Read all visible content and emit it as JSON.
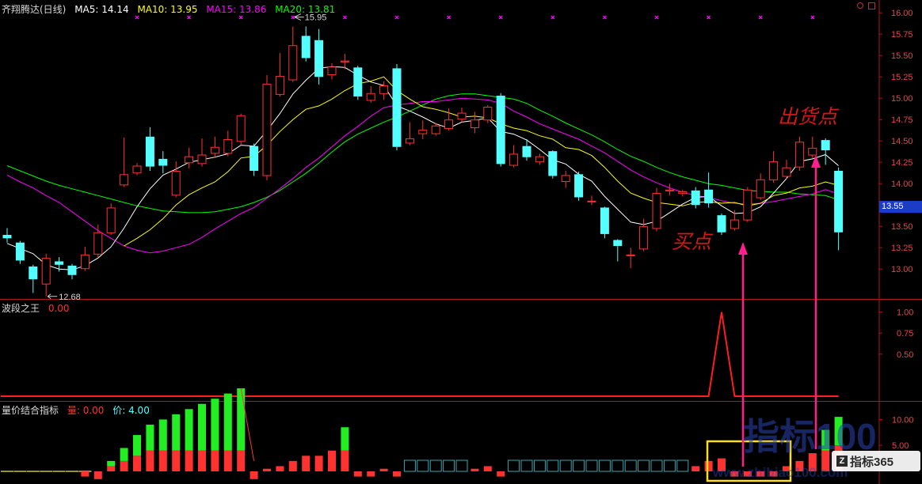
{
  "colors": {
    "up": "#ff3232",
    "down": "#54ffff",
    "ma5": "#ffffff",
    "ma10": "#ffff00",
    "ma15": "#ff00ff",
    "ma20": "#00ff00",
    "frame": "#b01818",
    "axis_text": "#e04848",
    "arrow": "#ff1e8c",
    "signal": "#ff1e1e",
    "marker": "#ff00ff"
  },
  "header": {
    "name": "齐翔腾达(日线)",
    "ma5": "MA5: 14.14",
    "ma10": "MA10: 13.95",
    "ma15": "MA15: 13.86",
    "ma20": "MA20: 13.81"
  },
  "panel2": {
    "name": "波段之王",
    "value": "0.00"
  },
  "panel3": {
    "name": "量价结合指标",
    "vol_label": "量: 0.00",
    "price_label": "价: 4.00"
  },
  "price_tag": "13.55",
  "annotations": {
    "sell_point": "出货点",
    "buy_point": "买点"
  },
  "watermarks": {
    "main": "指标100",
    "sub": "www.zhibiao100.com"
  },
  "brand": {
    "logo": "Z",
    "text": "指标365"
  },
  "chart_data": [
    {
      "type": "candlestick",
      "title": "齐翔腾达(日线)",
      "ylim": [
        12.65,
        16.15
      ],
      "yticks": [
        "16.00",
        "15.75",
        "15.50",
        "15.25",
        "15.00",
        "14.75",
        "14.50",
        "14.25",
        "14.00",
        "13.75",
        "13.50",
        "13.25",
        "13.00"
      ],
      "high_label": "15.95",
      "low_label": "12.68",
      "candles": [
        [
          13.4,
          13.36,
          13.48,
          13.31
        ],
        [
          13.31,
          13.1,
          13.33,
          13.06
        ],
        [
          13.03,
          12.88,
          13.05,
          12.72
        ],
        [
          12.82,
          13.13,
          13.18,
          12.68
        ],
        [
          13.09,
          13.05,
          13.14,
          12.97
        ],
        [
          13.04,
          12.93,
          13.06,
          12.88
        ],
        [
          13.0,
          13.17,
          13.26,
          12.98
        ],
        [
          13.17,
          13.43,
          13.52,
          13.14
        ],
        [
          13.42,
          13.72,
          13.77,
          13.4
        ],
        [
          13.98,
          14.11,
          14.54,
          13.96
        ],
        [
          14.12,
          14.21,
          14.24,
          14.1
        ],
        [
          14.55,
          14.2,
          14.66,
          14.15
        ],
        [
          14.29,
          14.21,
          14.38,
          14.12
        ],
        [
          13.86,
          14.15,
          14.26,
          13.84
        ],
        [
          14.24,
          14.32,
          14.42,
          14.18
        ],
        [
          14.23,
          14.34,
          14.53,
          14.2
        ],
        [
          14.35,
          14.43,
          14.55,
          14.3
        ],
        [
          14.35,
          14.52,
          14.62,
          14.32
        ],
        [
          14.49,
          14.8,
          14.82,
          14.45
        ],
        [
          14.44,
          14.15,
          14.47,
          14.09
        ],
        [
          14.09,
          15.17,
          15.27,
          14.04
        ],
        [
          15.04,
          15.26,
          15.53,
          15.02
        ],
        [
          15.21,
          15.62,
          15.84,
          15.19
        ],
        [
          15.73,
          15.47,
          15.84,
          15.43
        ],
        [
          15.68,
          15.25,
          15.81,
          15.16
        ],
        [
          15.27,
          15.37,
          15.41,
          15.22
        ],
        [
          15.42,
          15.44,
          15.52,
          15.34
        ],
        [
          15.36,
          15.02,
          15.38,
          14.98
        ],
        [
          14.97,
          15.06,
          15.14,
          14.95
        ],
        [
          15.05,
          15.15,
          15.2,
          14.98
        ],
        [
          15.35,
          14.43,
          15.4,
          14.39
        ],
        [
          14.47,
          14.53,
          14.72,
          14.45
        ],
        [
          14.58,
          14.63,
          14.74,
          14.52
        ],
        [
          14.58,
          14.68,
          14.71,
          14.56
        ],
        [
          14.64,
          14.75,
          14.88,
          14.62
        ],
        [
          14.75,
          14.83,
          14.89,
          14.72
        ],
        [
          14.65,
          14.75,
          14.84,
          14.59
        ],
        [
          14.74,
          14.9,
          14.92,
          14.71
        ],
        [
          15.03,
          14.23,
          15.06,
          14.2
        ],
        [
          14.21,
          14.35,
          14.45,
          14.19
        ],
        [
          14.44,
          14.31,
          14.52,
          14.27
        ],
        [
          14.25,
          14.32,
          14.35,
          14.22
        ],
        [
          14.38,
          14.09,
          14.39,
          14.06
        ],
        [
          14.02,
          14.1,
          14.15,
          13.95
        ],
        [
          14.11,
          13.84,
          14.14,
          13.8
        ],
        [
          13.79,
          13.8,
          13.86,
          13.75
        ],
        [
          13.72,
          13.41,
          13.73,
          13.36
        ],
        [
          13.34,
          13.27,
          13.35,
          13.09
        ],
        [
          13.17,
          13.17,
          13.25,
          13.01
        ],
        [
          13.23,
          13.5,
          13.59,
          13.21
        ],
        [
          13.47,
          13.89,
          13.95,
          13.44
        ],
        [
          13.91,
          13.93,
          14.0,
          13.86
        ],
        [
          13.88,
          13.91,
          13.93,
          13.85
        ],
        [
          13.92,
          13.75,
          13.96,
          13.71
        ],
        [
          13.93,
          13.77,
          14.13,
          13.72
        ],
        [
          13.63,
          13.43,
          13.65,
          13.4
        ],
        [
          13.47,
          13.58,
          13.69,
          13.45
        ],
        [
          13.57,
          13.93,
          13.96,
          13.55
        ],
        [
          13.83,
          14.05,
          14.12,
          13.81
        ],
        [
          14.04,
          14.26,
          14.38,
          14.01
        ],
        [
          14.08,
          14.19,
          14.28,
          14.06
        ],
        [
          14.19,
          14.49,
          14.55,
          14.15
        ],
        [
          14.33,
          14.42,
          14.55,
          14.3
        ],
        [
          14.51,
          14.39,
          14.53,
          14.22
        ],
        [
          14.15,
          13.43,
          14.19,
          13.22
        ]
      ],
      "ma5": [
        13.3,
        13.24,
        13.18,
        13.05,
        13.0,
        12.99,
        13.04,
        13.13,
        13.26,
        13.48,
        13.73,
        13.94,
        14.1,
        14.17,
        14.25,
        14.28,
        14.31,
        14.35,
        14.45,
        14.44,
        14.62,
        14.82,
        15.05,
        15.21,
        15.35,
        15.37,
        15.36,
        15.27,
        15.19,
        15.15,
        14.91,
        14.85,
        14.78,
        14.7,
        14.65,
        14.72,
        14.74,
        14.77,
        14.61,
        14.58,
        14.51,
        14.4,
        14.28,
        14.23,
        14.11,
        14.03,
        13.85,
        13.7,
        13.55,
        13.52,
        13.56,
        13.66,
        13.76,
        13.84,
        13.85,
        13.74,
        13.65,
        13.66,
        13.73,
        13.89,
        14.06,
        14.26,
        14.29,
        14.34,
        14.21
      ],
      "ma10": [
        null,
        null,
        null,
        null,
        null,
        null,
        null,
        null,
        null,
        13.27,
        13.36,
        13.46,
        13.59,
        13.75,
        13.87,
        13.95,
        14.02,
        14.14,
        14.3,
        14.32,
        14.45,
        14.61,
        14.75,
        14.87,
        14.91,
        14.99,
        15.09,
        15.17,
        15.2,
        15.25,
        15.09,
        14.99,
        14.9,
        14.87,
        14.83,
        14.78,
        14.79,
        14.77,
        14.7,
        14.65,
        14.62,
        14.56,
        14.52,
        14.42,
        14.4,
        14.33,
        14.19,
        14.03,
        13.89,
        13.83,
        13.78,
        13.76,
        13.74,
        13.78,
        13.79,
        13.77,
        13.78,
        13.74,
        13.77,
        13.86,
        13.89,
        13.95,
        13.97,
        14.02,
        13.98
      ],
      "ma15": [
        14.1,
        14.02,
        13.95,
        13.86,
        13.78,
        13.67,
        13.56,
        13.45,
        13.36,
        13.27,
        13.22,
        13.19,
        13.21,
        13.25,
        13.29,
        13.37,
        13.47,
        13.56,
        13.65,
        13.72,
        13.83,
        13.94,
        14.06,
        14.19,
        14.3,
        14.43,
        14.56,
        14.67,
        14.79,
        14.89,
        14.92,
        14.94,
        14.96,
        14.96,
        14.98,
        15.0,
        14.99,
        14.98,
        14.94,
        14.85,
        14.78,
        14.7,
        14.64,
        14.58,
        14.52,
        14.44,
        14.36,
        14.26,
        14.16,
        14.08,
        14.01,
        13.95,
        13.9,
        13.86,
        13.84,
        13.8,
        13.77,
        13.76,
        13.77,
        13.79,
        13.82,
        13.85,
        13.88,
        13.93,
        13.88
      ],
      "ma20": [
        14.21,
        14.15,
        14.09,
        14.03,
        13.98,
        13.94,
        13.9,
        13.86,
        13.82,
        13.78,
        13.74,
        13.71,
        13.68,
        13.67,
        13.66,
        13.66,
        13.67,
        13.7,
        13.73,
        13.78,
        13.84,
        13.92,
        14.02,
        14.12,
        14.24,
        14.37,
        14.49,
        14.58,
        14.65,
        14.72,
        14.78,
        14.85,
        14.92,
        14.99,
        15.03,
        15.05,
        15.05,
        15.03,
        15.01,
        14.99,
        14.94,
        14.86,
        14.79,
        14.71,
        14.64,
        14.57,
        14.49,
        14.4,
        14.32,
        14.26,
        14.19,
        14.13,
        14.08,
        14.04,
        14.0,
        13.98,
        13.95,
        13.92,
        13.91,
        13.9,
        13.9,
        13.88,
        13.87,
        13.86,
        13.81
      ]
    },
    {
      "type": "line",
      "title": "波段之王",
      "ylim": [
        0,
        1.1
      ],
      "yticks": [
        "1.00",
        "0.75",
        "0.50"
      ],
      "spike_index": 55,
      "values": [
        0,
        0,
        0,
        0,
        0,
        0,
        0,
        0,
        0,
        0,
        0,
        0,
        0,
        0,
        0,
        0,
        0,
        0,
        0,
        0,
        0,
        0,
        0,
        0,
        0,
        0,
        0,
        0,
        0,
        0,
        0,
        0,
        0,
        0,
        0,
        0,
        0,
        0,
        0,
        0,
        0,
        0,
        0,
        0,
        0,
        0,
        0,
        0,
        0,
        0,
        0,
        0,
        0,
        0,
        0,
        1,
        0,
        0,
        0,
        0,
        0,
        0,
        0,
        0,
        0
      ]
    },
    {
      "type": "bar",
      "title": "量价结合指标",
      "ylim": [
        -1.5,
        12.5
      ],
      "yticks": [
        "10.00",
        "5.00"
      ],
      "series": [
        {
          "name": "量",
          "values": [
            0,
            0,
            0,
            0,
            0,
            0,
            -1.0,
            -1.5,
            1.0,
            2.0,
            3.0,
            4.0,
            4.0,
            4.0,
            4.0,
            4.0,
            4.0,
            4.0,
            4.0,
            -1.5,
            0.5,
            1.0,
            2.0,
            3.0,
            3.0,
            4.0,
            4.0,
            -1.0,
            -1.0,
            0.5,
            -1.0,
            0,
            0,
            0,
            0,
            0,
            0.5,
            1.0,
            -1.0,
            0,
            0,
            0,
            0,
            0,
            0,
            0,
            0,
            0,
            0,
            0,
            0,
            0,
            0,
            1.0,
            2.0,
            2.5,
            -1.0,
            -1.0,
            -1.0,
            -1.0,
            1.0,
            2.0,
            3.5,
            4.0,
            5.0
          ]
        },
        {
          "name": "价",
          "values": [
            0,
            0,
            0,
            0,
            0,
            0,
            0,
            0,
            1.0,
            2.5,
            4.0,
            5.0,
            6.0,
            7.0,
            8.0,
            9.0,
            10.0,
            11.0,
            12.0,
            0,
            0,
            0,
            0,
            0,
            0,
            0,
            4.5,
            0,
            0,
            0,
            0,
            0,
            0,
            0,
            0,
            0,
            0,
            0,
            0,
            0,
            0,
            0,
            0,
            0,
            0,
            0,
            0,
            0,
            0,
            0,
            0,
            0,
            0,
            0,
            0,
            0,
            0,
            0,
            0,
            0,
            0,
            0,
            0,
            4.0,
            5.5
          ]
        }
      ]
    }
  ]
}
